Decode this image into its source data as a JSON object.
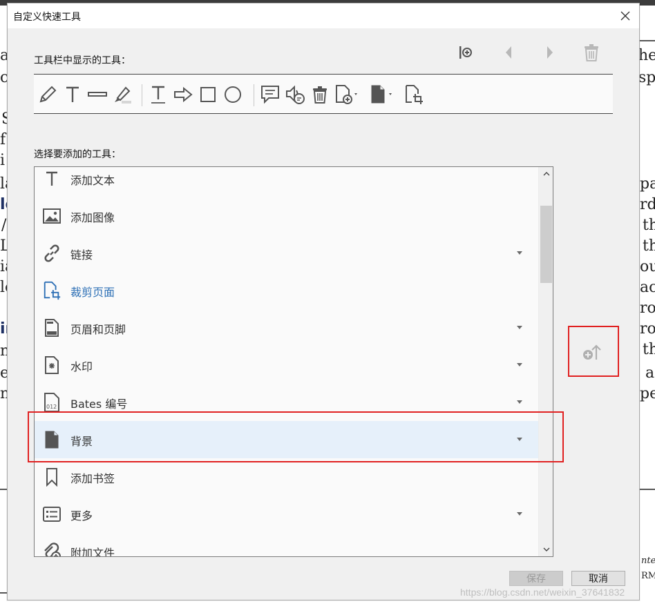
{
  "dialog": {
    "title": "自定义快速工具",
    "toolbar_section_label": "工具栏中显示的工具：",
    "add_section_label": "选择要添加的工具：",
    "save_label": "保存",
    "cancel_label": "取消"
  },
  "top_actions": [
    "insert-separator-icon",
    "move-left-icon",
    "move-right-icon",
    "delete-icon"
  ],
  "toolbar_tools": [
    "pencil-icon",
    "add-text-icon",
    "strikethrough-icon",
    "highlighter-icon",
    "underline-text-icon",
    "arrow-icon",
    "rectangle-icon",
    "circle-icon",
    "comment-icon",
    "audio-comment-icon",
    "trash-icon",
    "insert-page-icon",
    "page-menu-icon",
    "crop-page-icon"
  ],
  "tool_list": [
    {
      "label": "添加文本",
      "icon": "text-icon",
      "has_menu": false
    },
    {
      "label": "添加图像",
      "icon": "image-icon",
      "has_menu": false
    },
    {
      "label": "链接",
      "icon": "link-icon",
      "has_menu": true
    },
    {
      "label": "裁剪页面",
      "icon": "crop-page-icon",
      "has_menu": false,
      "highlighted_text": true
    },
    {
      "label": "页眉和页脚",
      "icon": "header-footer-icon",
      "has_menu": true
    },
    {
      "label": "水印",
      "icon": "watermark-icon",
      "has_menu": true
    },
    {
      "label": "Bates 编号",
      "icon": "bates-icon",
      "has_menu": true
    },
    {
      "label": "背景",
      "icon": "background-icon",
      "has_menu": true,
      "selected": true
    },
    {
      "label": "添加书签",
      "icon": "bookmark-icon",
      "has_menu": false
    },
    {
      "label": "更多",
      "icon": "more-icon",
      "has_menu": true
    },
    {
      "label": "附加文件",
      "icon": "attach-file-icon",
      "has_menu": false
    }
  ],
  "add_to_toolbar_icon": "add-to-toolbar-icon",
  "watermark_text": "https://blog.csdn.net/weixin_37641832",
  "background_text_fragments": [
    "he",
    "sp",
    "pa",
    "rd",
    "th",
    "th",
    "ou",
    "ace",
    "ro",
    "ro",
    "th",
    "a",
    "pe",
    "nte",
    "RM",
    "a",
    "c",
    "S",
    "f",
    "i",
    "la",
    "lc",
    "/",
    "Lc",
    "ia",
    "lc",
    "ir",
    "n",
    "e",
    "n"
  ],
  "colors": {
    "accent_blue": "#2c6fb5",
    "selection": "#e6f0fa",
    "annotation_red": "#e02020"
  }
}
